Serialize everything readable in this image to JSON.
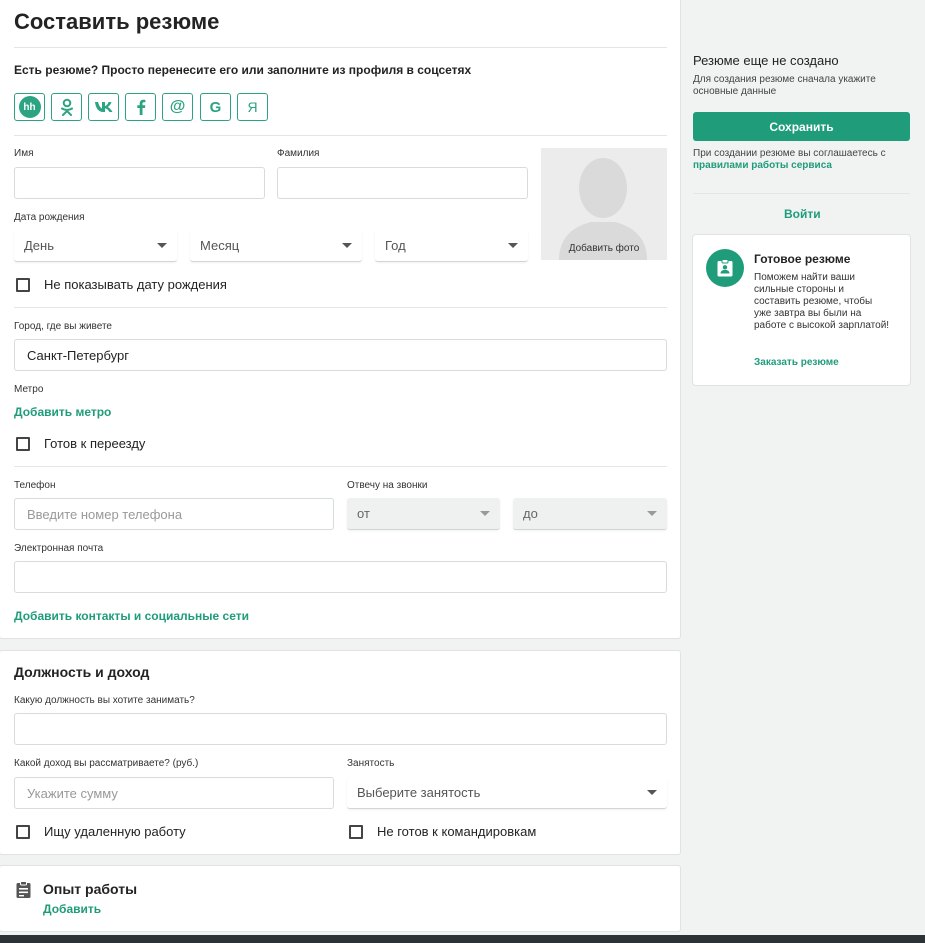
{
  "main": {
    "title": "Составить резюме",
    "import_text": "Есть резюме? Просто перенесите его или заполните из профиля в соцсетях",
    "social": [
      {
        "icon": "hh-icon",
        "glyph": "hh"
      },
      {
        "icon": "odnoklassniki-icon",
        "glyph": "ok"
      },
      {
        "icon": "vk-icon",
        "glyph": "vk"
      },
      {
        "icon": "facebook-icon",
        "glyph": "f"
      },
      {
        "icon": "mail-ru-icon",
        "glyph": "@"
      },
      {
        "icon": "google-icon",
        "glyph": "G"
      },
      {
        "icon": "yandex-icon",
        "glyph": "Я"
      }
    ],
    "first_name_label": "Имя",
    "first_name_value": "",
    "last_name_label": "Фамилия",
    "last_name_value": "",
    "birth_label": "Дата рождения",
    "day_placeholder": "День",
    "month_placeholder": "Месяц",
    "year_placeholder": "Год",
    "add_photo": "Добавить фото",
    "hide_birth": "Не показывать дату рождения",
    "city_label": "Город, где вы живете",
    "city_value": "Санкт-Петербург",
    "metro_label": "Метро",
    "add_metro": "Добавить метро",
    "relocation": "Готов к переезду",
    "phone_label": "Телефон",
    "phone_placeholder": "Введите номер телефона",
    "calls_label": "Отвечу на звонки",
    "from_placeholder": "от",
    "to_placeholder": "до",
    "email_label": "Электронная почта",
    "email_value": "",
    "add_contacts": "Добавить контакты и социальные сети"
  },
  "position": {
    "title": "Должность и доход",
    "position_label": "Какую должность вы хотите занимать?",
    "position_value": "",
    "salary_label": "Какой доход вы рассматриваете? (руб.)",
    "salary_placeholder": "Укажите сумму",
    "employment_label": "Занятость",
    "employment_placeholder": "Выберите занятость",
    "remote": "Ищу удаленную работу",
    "no_trips": "Не готов к командировкам"
  },
  "experience": {
    "title": "Опыт работы",
    "add": "Добавить"
  },
  "sidebar": {
    "status": "Резюме еще не создано",
    "hint": "Для создания резюме сначала укажите основные данные",
    "save": "Сохранить",
    "agree_prefix": "При создании резюме вы соглашаетесь с",
    "agree_link": "правилами работы сервиса",
    "login": "Войти",
    "promo_title": "Готовое резюме",
    "promo_text": "Поможем найти ваши сильные стороны и составить резюме, чтобы уже завтра вы были на работе с высокой зарплатой!",
    "promo_link": "Заказать резюме"
  },
  "colors": {
    "accent": "#1f9c7a",
    "background": "#f1f3f3",
    "footer": "#2c3336"
  }
}
